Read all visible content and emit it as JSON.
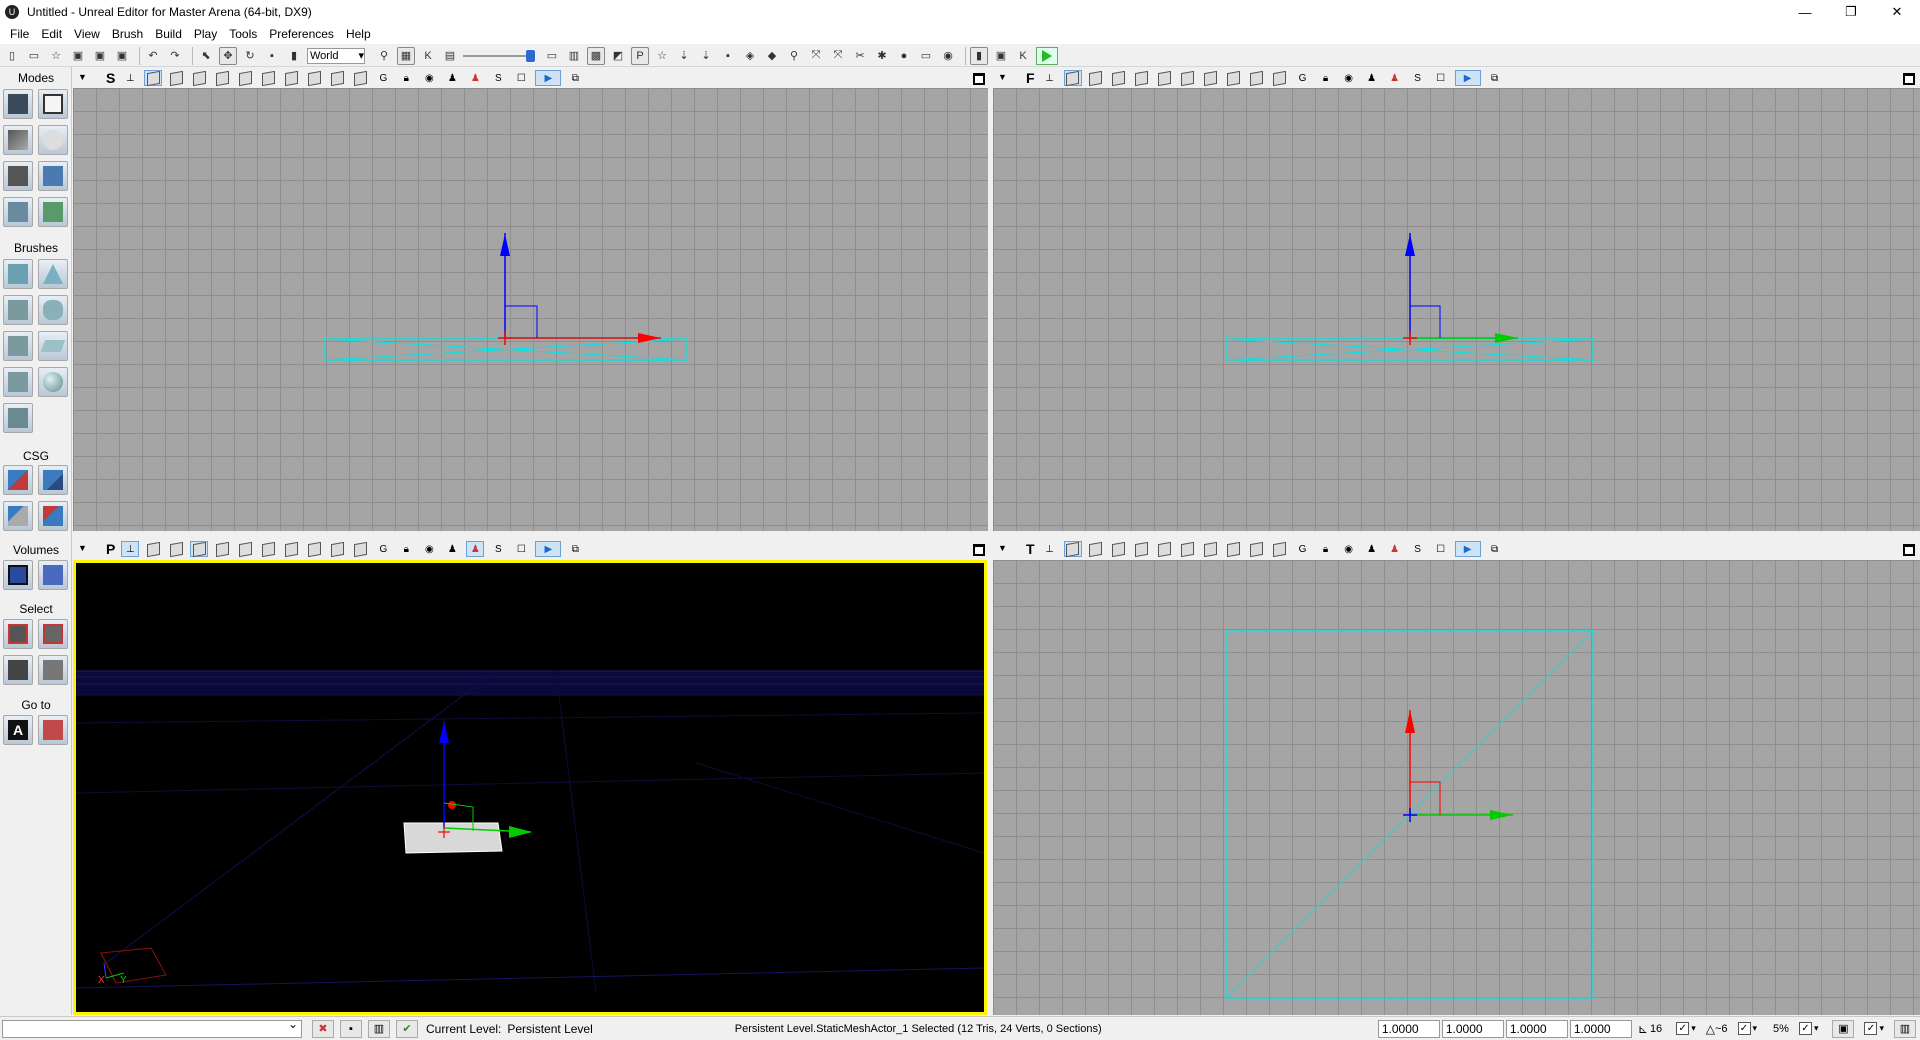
{
  "window": {
    "title": "Untitled - Unreal Editor for Master Arena (64-bit, DX9)",
    "minimize": "—",
    "restore": "❐",
    "close": "✕"
  },
  "menu": [
    "File",
    "Edit",
    "View",
    "Brush",
    "Build",
    "Play",
    "Tools",
    "Preferences",
    "Help"
  ],
  "toolbar": {
    "coordinate_system": "World"
  },
  "left_panel": {
    "modes_label": "Modes",
    "brushes_label": "Brushes",
    "csg_label": "CSG",
    "volumes_label": "Volumes",
    "select_label": "Select",
    "goto_label": "Go to"
  },
  "viewports": {
    "top_left": {
      "label": "S"
    },
    "top_right": {
      "label": "F"
    },
    "bottom_left": {
      "label": "P"
    },
    "bottom_right": {
      "label": "T"
    }
  },
  "status": {
    "current_level_label": "Current Level:",
    "current_level_value": "Persistent Level",
    "selection_text": "Persistent Level.StaticMeshActor_1 Selected (12 Tris, 24 Verts, 0 Sections)",
    "scale_x": "1.0000",
    "scale_y": "1.0000",
    "scale_z": "1.0000",
    "scale_w": "1.0000",
    "grid_size": "16",
    "rotation_snap": "~6",
    "scale_snap": "5%"
  },
  "colors": {
    "grid_bg": "#a5a5a5",
    "selection_cyan": "#00e5e5",
    "axis_x": "#ff0000",
    "axis_y": "#00cc00",
    "axis_z": "#0000ff",
    "active_viewport_border": "#fff200"
  }
}
